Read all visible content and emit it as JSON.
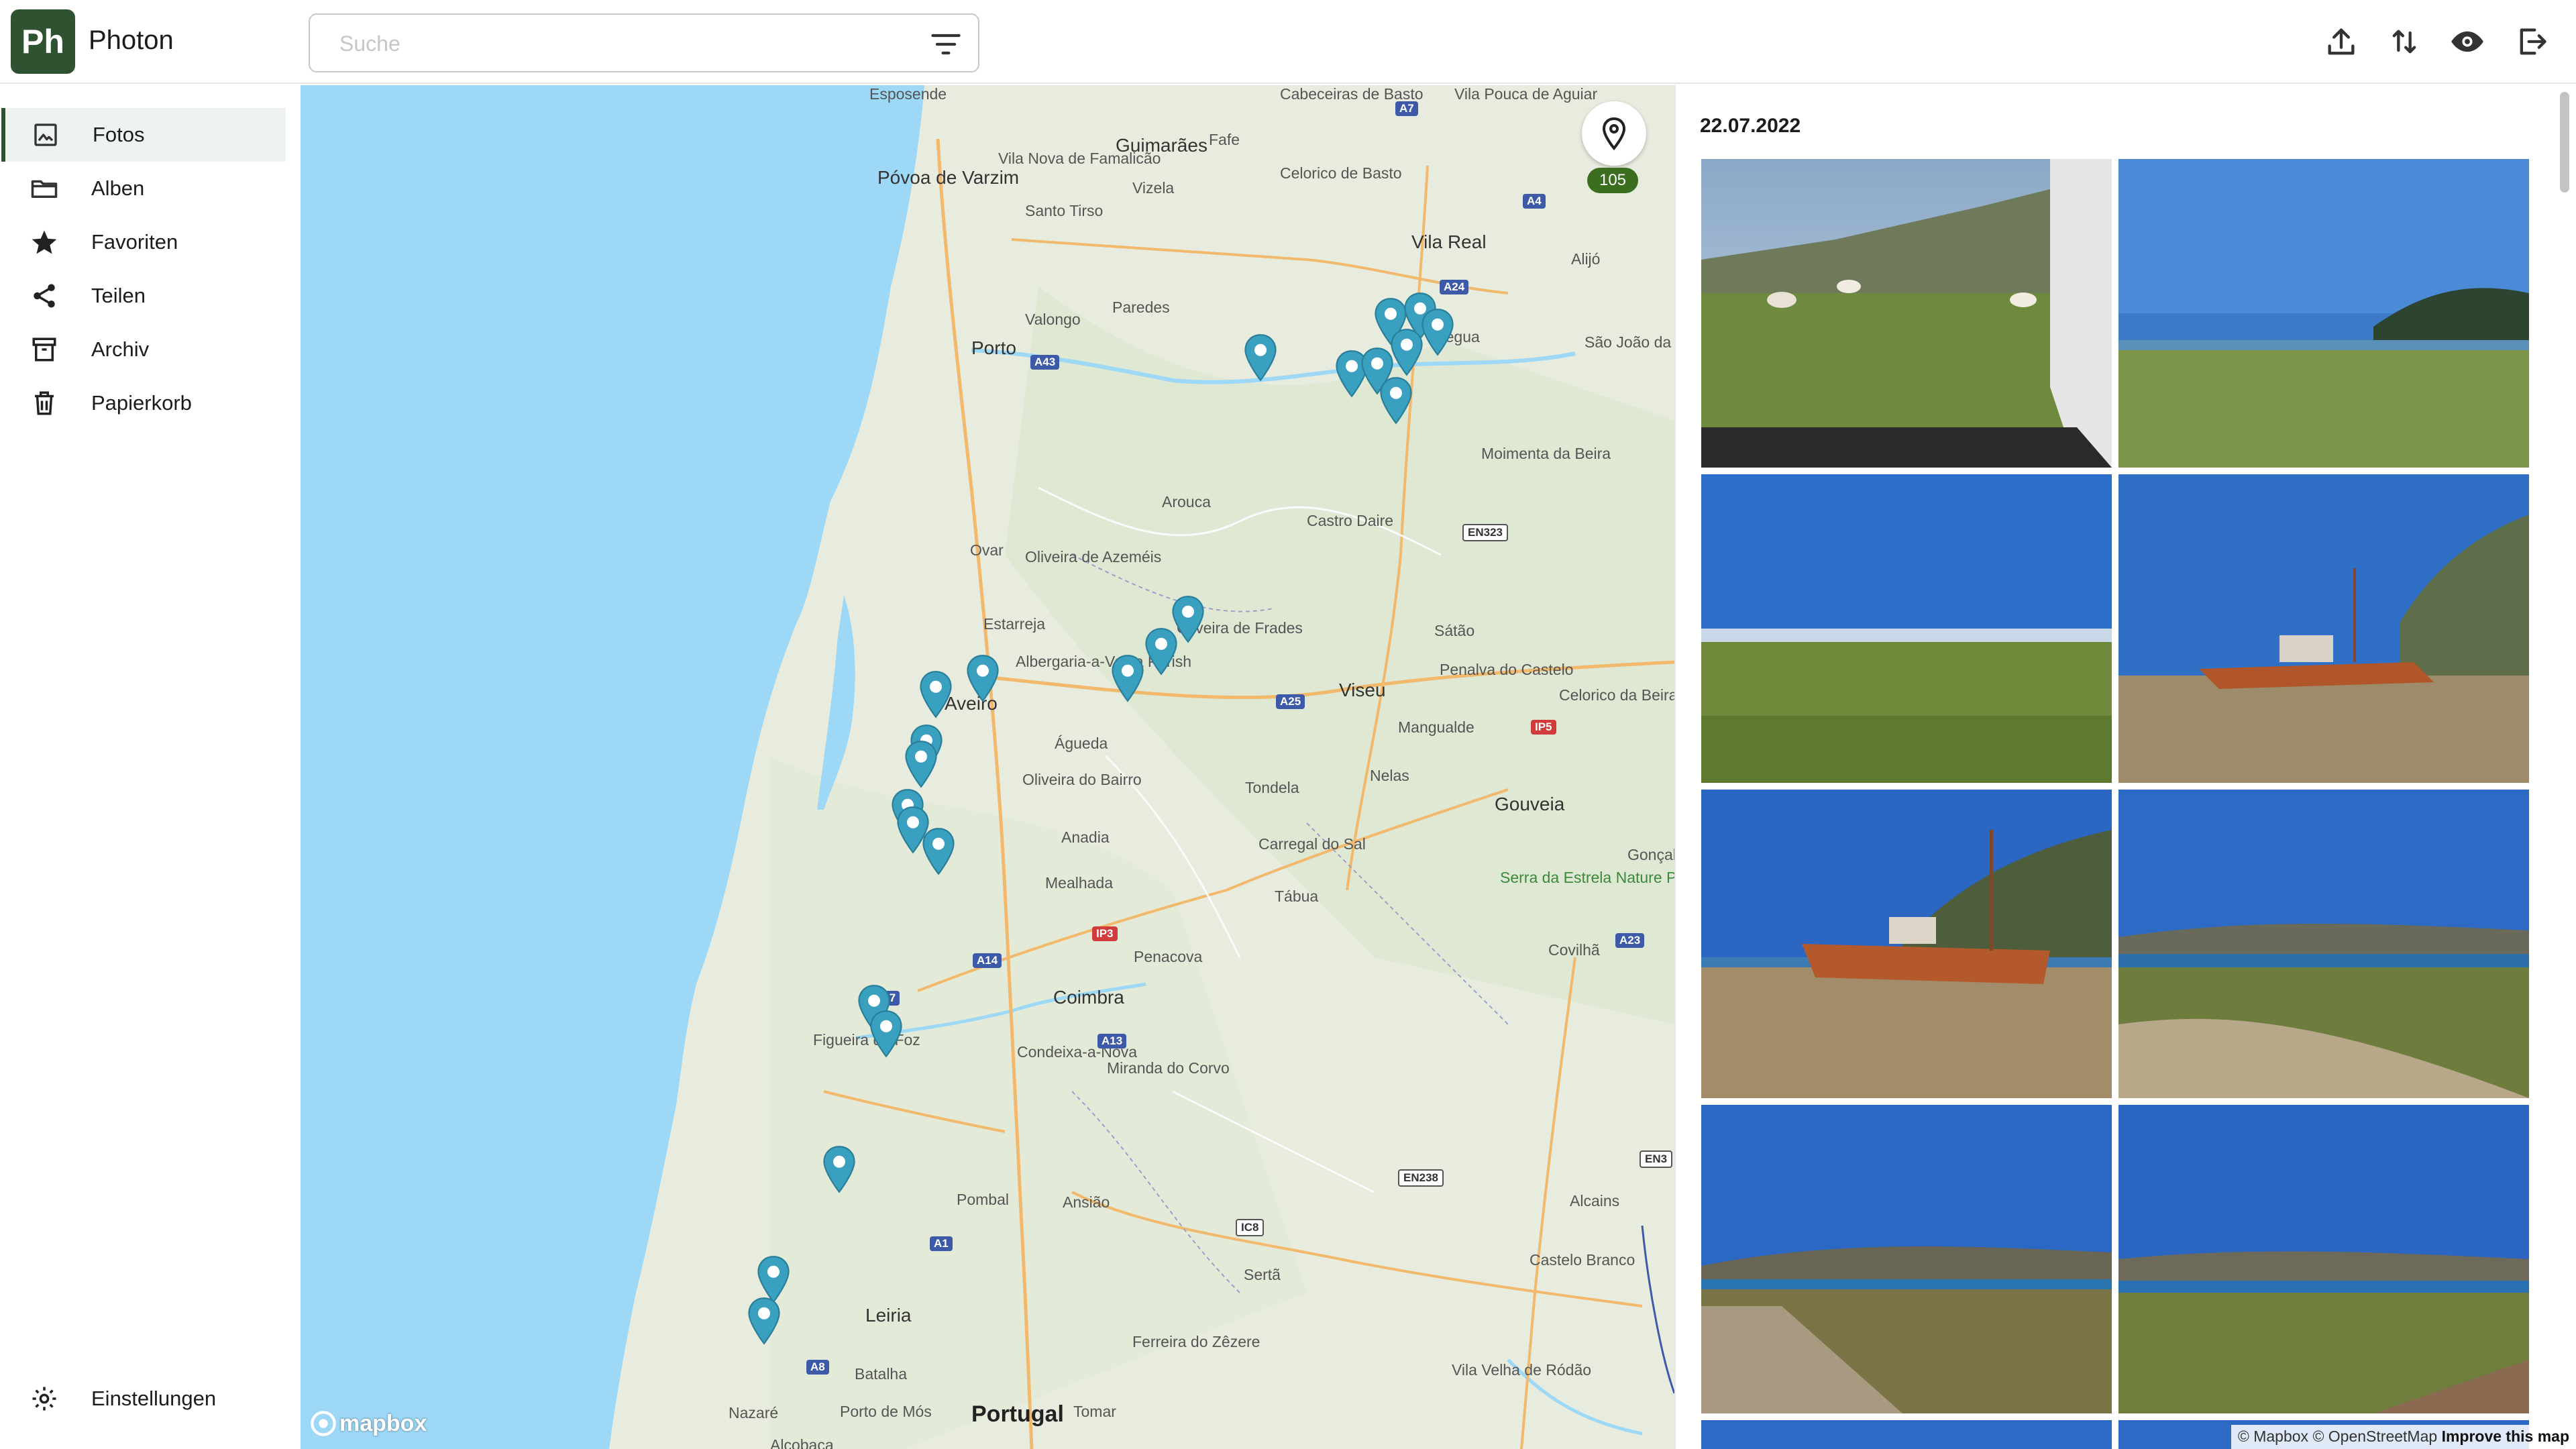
{
  "app": {
    "logo_text": "Ph",
    "title": "Photon"
  },
  "search": {
    "placeholder": "Suche",
    "value": ""
  },
  "header_icons": [
    "upload-icon",
    "sort-icon",
    "eye-icon",
    "logout-icon"
  ],
  "sidebar": {
    "items": [
      {
        "label": "Fotos",
        "icon": "photo-icon",
        "active": true
      },
      {
        "label": "Alben",
        "icon": "folder-icon"
      },
      {
        "label": "Favoriten",
        "icon": "star-icon"
      },
      {
        "label": "Teilen",
        "icon": "share-icon"
      },
      {
        "label": "Archiv",
        "icon": "archive-icon"
      },
      {
        "label": "Papierkorb",
        "icon": "trash-icon"
      }
    ],
    "settings_label": "Einstellungen"
  },
  "map": {
    "photo_count": "105",
    "logo": "mapbox",
    "country_label": "Portugal",
    "labels": [
      "Vila Pouca de Aguiar",
      "Póvoa de Varzim",
      "Guimarães",
      "Fafe",
      "Vila Nova de Famalicão",
      "Celorico de Basto",
      "Vizela",
      "Santo Tirso",
      "Alijó",
      "Vila Real",
      "Paredes",
      "Régua",
      "São João da Pesqueira",
      "Porto",
      "Valongo",
      "Moimenta da Beira",
      "Arouca",
      "Castro Daire",
      "Ovar",
      "Oliveira de Azeméis",
      "Estarreja",
      "Albergaria-a-Velha Parish",
      "Oliveira de Frades",
      "Sátão",
      "Penalva do Castelo",
      "Viseu",
      "Celorico da Beira",
      "Aveiro",
      "Mangualde",
      "Águeda",
      "Oliveira do Bairro",
      "Tondela",
      "Nelas",
      "Gouveia",
      "Anadia",
      "Carregal do Sal",
      "Gonçal",
      "Serra da Estrela Nature Park",
      "Mealhada",
      "Tábua",
      "Penacova",
      "Covilhã",
      "Coimbra",
      "Figueira da Foz",
      "Condeixa-a-Nova",
      "Miranda do Corvo",
      "Pombal",
      "Ansião",
      "Alcains",
      "Castelo Branco",
      "Sertã",
      "Leiria",
      "Batalha",
      "Ferreira do Zêzere",
      "Vila Velha de Ródão",
      "Nazaré",
      "Porto de Mós",
      "Tomar",
      "Alcobaça",
      "Esposende",
      "Cabeceiras de Basto"
    ],
    "roads": [
      "A7",
      "A4",
      "A24",
      "A43",
      "EN323",
      "A25",
      "IP5",
      "A14",
      "A17",
      "A13",
      "IP3",
      "A23",
      "EN238",
      "IC8",
      "A1",
      "A8",
      "EN3"
    ]
  },
  "gallery": {
    "date": "22.07.2022",
    "photos": [
      "landscape with sheep through window",
      "green plain with cliff and fjord",
      "wide grassland with sea",
      "rusty shipwreck on shore",
      "rusty shipwreck close",
      "gravel road and fjord",
      "gravel road downhill to fjord",
      "green hills with fjord"
    ]
  },
  "attribution": {
    "mapbox": "© Mapbox",
    "osm": "© OpenStreetMap",
    "improve": "Improve this map"
  }
}
